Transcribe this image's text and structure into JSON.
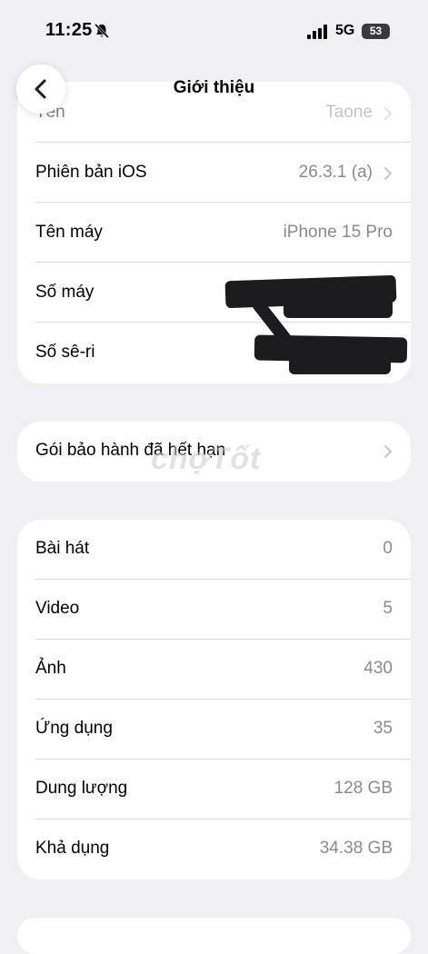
{
  "status": {
    "time": "11:25",
    "network": "5G",
    "battery": "53"
  },
  "nav": {
    "title": "Giới thiệu"
  },
  "card1": {
    "rows": [
      {
        "label": "Tên",
        "value": "Taone"
      },
      {
        "label": "Phiên bản iOS",
        "value": "26.3.1 (a)"
      },
      {
        "label": "Tên máy",
        "value": "iPhone 15 Pro"
      },
      {
        "label": "Số máy",
        "value": ""
      },
      {
        "label": "Số sê-ri",
        "value": ""
      }
    ]
  },
  "warranty": {
    "label": "Gói bảo hành đã hết hạn"
  },
  "stats": {
    "rows": [
      {
        "label": "Bài hát",
        "value": "0"
      },
      {
        "label": "Video",
        "value": "5"
      },
      {
        "label": "Ảnh",
        "value": "430"
      },
      {
        "label": "Ứng dụng",
        "value": "35"
      },
      {
        "label": "Dung lượng",
        "value": "128 GB"
      },
      {
        "label": "Khả dụng",
        "value": "34.38 GB"
      }
    ]
  },
  "watermark": "chợTốt"
}
